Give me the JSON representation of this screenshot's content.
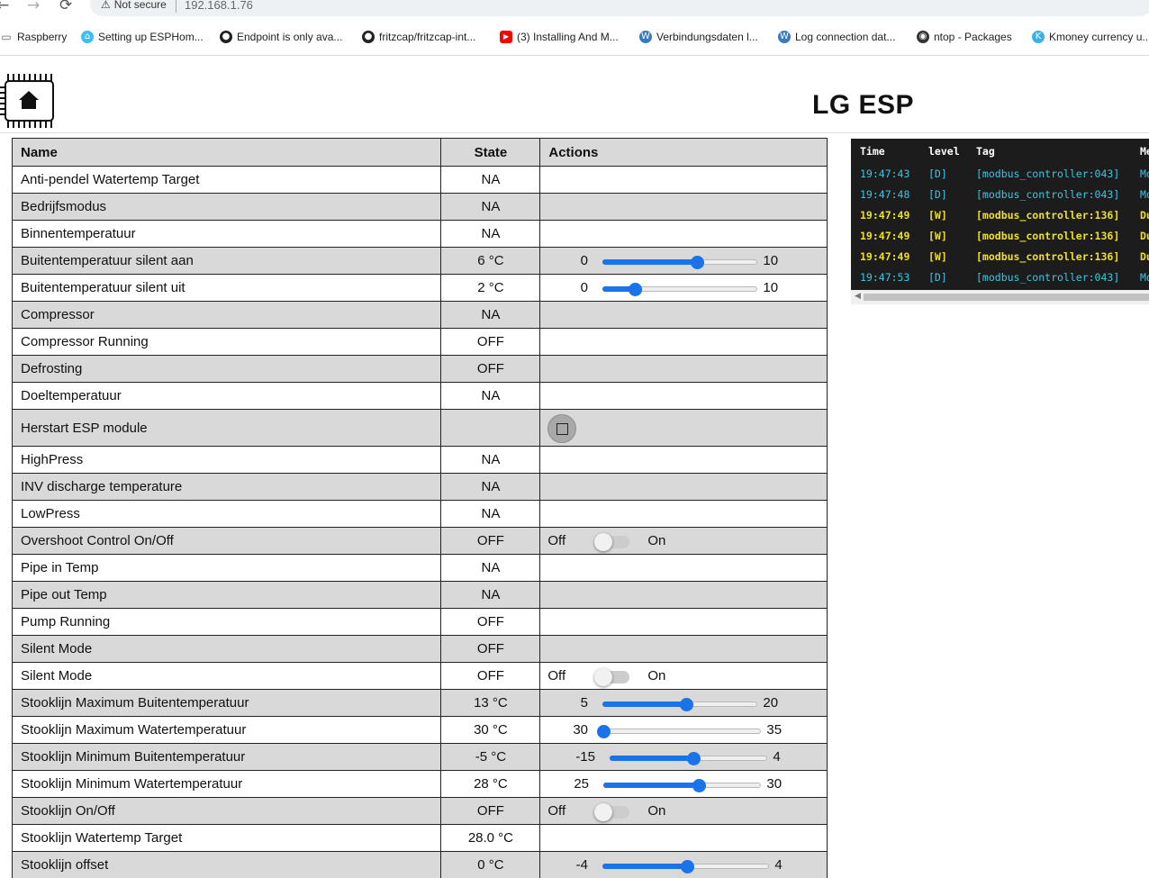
{
  "browser": {
    "not_secure": "Not secure",
    "url": "192.168.1.76",
    "bookmarks": [
      {
        "label": "Raspberry",
        "icon": "folder-icon",
        "color": "#666666"
      },
      {
        "label": "Setting up ESPHom...",
        "icon": "home-assistant-icon",
        "color": "#41bdf5"
      },
      {
        "label": "Endpoint is only ava...",
        "icon": "github-icon",
        "color": "#222222"
      },
      {
        "label": "fritzcap/fritzcap-int...",
        "icon": "github-icon",
        "color": "#222222"
      },
      {
        "label": "(3) Installing And M...",
        "icon": "youtube-icon",
        "color": "#ff0000"
      },
      {
        "label": "Verbindungsdaten l...",
        "icon": "wordpress-icon",
        "color": "#3a7bbf"
      },
      {
        "label": "Log connection dat...",
        "icon": "wordpress-icon",
        "color": "#3a7bbf"
      },
      {
        "label": "ntop - Packages",
        "icon": "globe-icon",
        "color": "#333333"
      },
      {
        "label": "Kmoney currency u...",
        "icon": "kde-icon",
        "color": "#3daee9"
      }
    ]
  },
  "page": {
    "title": "LG ESP",
    "logo_icon": "home-chip-icon"
  },
  "table": {
    "headers": {
      "name": "Name",
      "state": "State",
      "actions": "Actions"
    },
    "toggle_off_label": "Off",
    "toggle_on_label": "On",
    "rows": [
      {
        "name": "Anti-pendel Watertemp Target",
        "state": "NA"
      },
      {
        "name": "Bedrijfsmodus",
        "state": "NA"
      },
      {
        "name": "Binnentemperatuur",
        "state": "NA"
      },
      {
        "name": "Buitentemperatuur silent aan",
        "state": "6 °C",
        "slider": {
          "min": "0",
          "max": "10",
          "value": 6
        }
      },
      {
        "name": "Buitentemperatuur silent uit",
        "state": "2 °C",
        "slider": {
          "min": "0",
          "max": "10",
          "value": 2
        }
      },
      {
        "name": "Compressor",
        "state": "NA"
      },
      {
        "name": "Compressor Running",
        "state": "OFF"
      },
      {
        "name": "Defrosting",
        "state": "OFF"
      },
      {
        "name": "Doeltemperatuur",
        "state": "NA"
      },
      {
        "name": "Herstart ESP module",
        "state": "",
        "button": true
      },
      {
        "name": "HighPress",
        "state": "NA"
      },
      {
        "name": "INV discharge temperature",
        "state": "NA"
      },
      {
        "name": "LowPress",
        "state": "NA"
      },
      {
        "name": "Overshoot Control On/Off",
        "state": "OFF",
        "toggle": {
          "checked": false
        }
      },
      {
        "name": "Pipe in Temp",
        "state": "NA"
      },
      {
        "name": "Pipe out Temp",
        "state": "NA"
      },
      {
        "name": "Pump Running",
        "state": "OFF"
      },
      {
        "name": "Silent Mode",
        "state": "OFF"
      },
      {
        "name": "Silent Mode",
        "state": "OFF",
        "toggle": {
          "checked": false
        }
      },
      {
        "name": "Stooklijn Maximum Buitentemperatuur",
        "state": "13 °C",
        "slider": {
          "min": "5",
          "max": "20",
          "value": 13
        }
      },
      {
        "name": "Stooklijn Maximum Watertemperatuur",
        "state": "30 °C",
        "slider": {
          "min": "30",
          "max": "35",
          "value": 30
        }
      },
      {
        "name": "Stooklijn Minimum Buitentemperatuur",
        "state": "-5 °C",
        "slider": {
          "min": "-15",
          "max": "4",
          "value": -5
        }
      },
      {
        "name": "Stooklijn Minimum Watertemperatuur",
        "state": "28 °C",
        "slider": {
          "min": "25",
          "max": "30",
          "value": 28
        }
      },
      {
        "name": "Stooklijn On/Off",
        "state": "OFF",
        "toggle": {
          "checked": false
        }
      },
      {
        "name": "Stooklijn Watertemp Target",
        "state": "28.0 °C"
      },
      {
        "name": "Stooklijn offset",
        "state": "0 °C",
        "slider": {
          "min": "-4",
          "max": "4",
          "value": 0
        }
      }
    ]
  },
  "log": {
    "headers": {
      "time": "Time",
      "level": "level",
      "tag": "Tag",
      "message": "Me"
    },
    "rows": [
      {
        "time": "19:47:43",
        "level": "[D]",
        "tag": "[modbus_controller:043]",
        "message": "Mo",
        "kind": "d"
      },
      {
        "time": "19:47:48",
        "level": "[D]",
        "tag": "[modbus_controller:043]",
        "message": "Mo",
        "kind": "d"
      },
      {
        "time": "19:47:49",
        "level": "[W]",
        "tag": "[modbus_controller:136]",
        "message": "Du",
        "kind": "w"
      },
      {
        "time": "19:47:49",
        "level": "[W]",
        "tag": "[modbus_controller:136]",
        "message": "Du",
        "kind": "w"
      },
      {
        "time": "19:47:49",
        "level": "[W]",
        "tag": "[modbus_controller:136]",
        "message": "Du",
        "kind": "w"
      },
      {
        "time": "19:47:53",
        "level": "[D]",
        "tag": "[modbus_controller:043]",
        "message": "Mo",
        "kind": "d"
      }
    ]
  }
}
